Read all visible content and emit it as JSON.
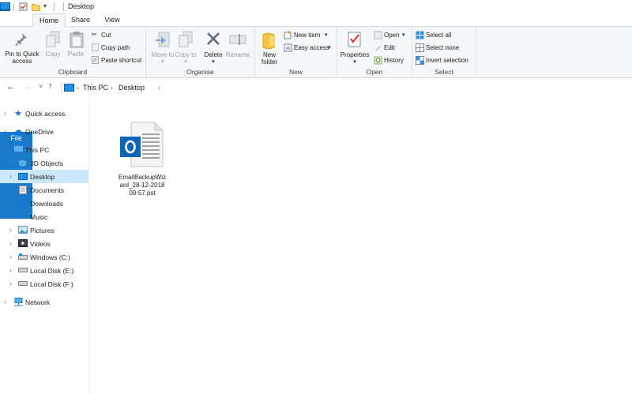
{
  "window": {
    "title": "Desktop"
  },
  "tabs": {
    "file": "File",
    "home": "Home",
    "share": "Share",
    "view": "View"
  },
  "ribbon": {
    "clipboard": {
      "label": "Clipboard",
      "pin": "Pin to Quick access",
      "copy": "Copy",
      "paste": "Paste",
      "cut": "Cut",
      "copy_path": "Copy path",
      "paste_shortcut": "Paste shortcut"
    },
    "organise": {
      "label": "Organise",
      "move_to": "Move to",
      "copy_to": "Copy to",
      "delete": "Delete",
      "rename": "Rename"
    },
    "new": {
      "label": "New",
      "new_folder": "New folder",
      "new_item": "New item",
      "easy_access": "Easy access"
    },
    "open": {
      "label": "Open",
      "properties": "Properties",
      "open": "Open",
      "edit": "Edit",
      "history": "History"
    },
    "select": {
      "label": "Select",
      "select_all": "Select all",
      "select_none": "Select none",
      "invert_selection": "Invert selection"
    }
  },
  "address": {
    "crumbs": [
      "This PC",
      "Desktop"
    ]
  },
  "nav": {
    "items": [
      {
        "label": "Quick access"
      },
      {
        "label": "OneDrive"
      },
      {
        "label": "This PC"
      },
      {
        "label": "3D Objects"
      },
      {
        "label": "Desktop"
      },
      {
        "label": "Documents"
      },
      {
        "label": "Downloads"
      },
      {
        "label": "Music"
      },
      {
        "label": "Pictures"
      },
      {
        "label": "Videos"
      },
      {
        "label": "Windows (C:)"
      },
      {
        "label": "Local Disk (E:)"
      },
      {
        "label": "Local Disk (F:)"
      },
      {
        "label": "Network"
      }
    ]
  },
  "content": {
    "files": [
      {
        "line1": "EmailBackupWiz",
        "line2": "ard_28-12-2018",
        "line3": "09-57.pst",
        "icon": "outlook-pst-icon"
      }
    ]
  },
  "colors": {
    "accent": "#1979ca",
    "selection": "#cce8ff",
    "outlook": "#0f64b6"
  }
}
